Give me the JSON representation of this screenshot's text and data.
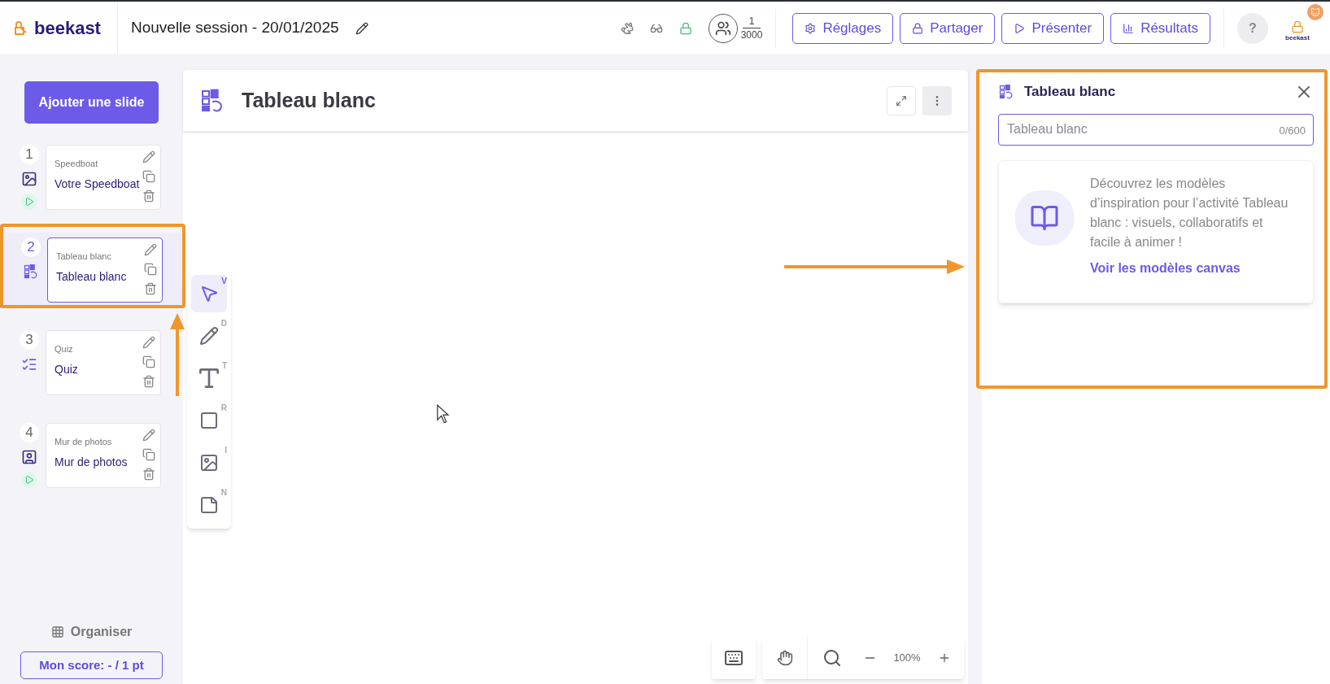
{
  "logo": {
    "text": "beekast"
  },
  "session_title": "Nouvelle session - 20/01/2025",
  "participants": {
    "count": "1",
    "max": "3000"
  },
  "header_buttons": [
    {
      "label": "Réglages",
      "kind": "settings"
    },
    {
      "label": "Partager",
      "kind": "share"
    },
    {
      "label": "Présenter",
      "kind": "present"
    },
    {
      "label": "Résultats",
      "kind": "results"
    }
  ],
  "help": "?",
  "account_label": "beekast",
  "add_slide": "Ajouter une slide",
  "slides": [
    {
      "number": "1",
      "type_label": "Speedboat",
      "title": "Votre Speedboat",
      "kind": "image",
      "selected": false,
      "playable": true
    },
    {
      "number": "2",
      "type_label": "Tableau blanc",
      "title": "Tableau blanc",
      "kind": "whiteboard",
      "selected": true,
      "playable": false
    },
    {
      "number": "3",
      "type_label": "Quiz",
      "title": "Quiz",
      "kind": "quiz",
      "selected": false,
      "playable": false
    },
    {
      "number": "4",
      "type_label": "Mur de photos",
      "title": "Mur de photos",
      "kind": "photo",
      "selected": false,
      "playable": true
    }
  ],
  "organise": "Organiser",
  "score": "Mon score: - / 1 pt",
  "canvas": {
    "title": "Tableau blanc"
  },
  "tools": [
    {
      "kind": "select",
      "shortcut": "V",
      "selected": true
    },
    {
      "kind": "pencil",
      "shortcut": "D",
      "selected": false
    },
    {
      "kind": "text",
      "shortcut": "T",
      "selected": false
    },
    {
      "kind": "shape",
      "shortcut": "R",
      "selected": false
    },
    {
      "kind": "image",
      "shortcut": "I",
      "selected": false
    },
    {
      "kind": "note",
      "shortcut": "N",
      "selected": false
    }
  ],
  "zoom": "100%",
  "panel": {
    "title": "Tableau blanc",
    "input_placeholder": "Tableau blanc",
    "counter": "0/600",
    "promo_text": "Découvrez les modèles d’inspiration pour l’activité Tableau blanc : visuels, collaboratifs et facile à animer !",
    "promo_link": "Voir les modèles canvas"
  }
}
